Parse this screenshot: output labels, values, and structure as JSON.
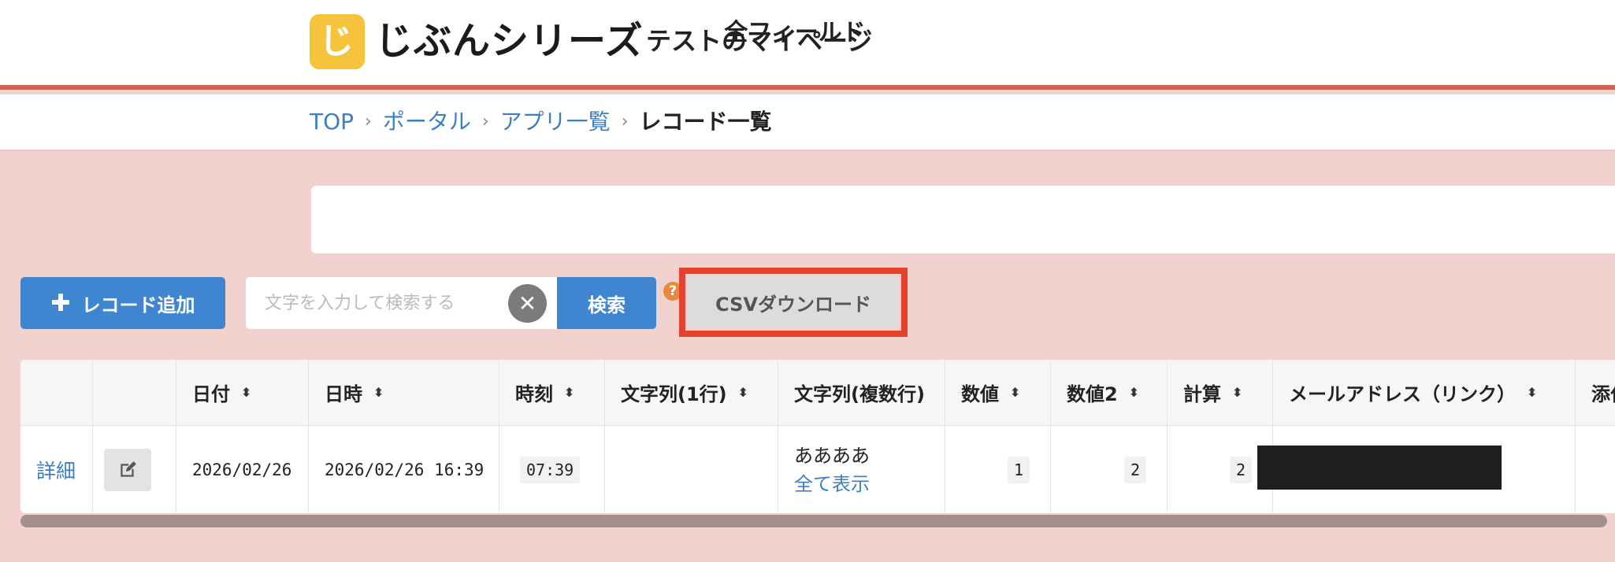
{
  "header": {
    "logo_mark": "じ",
    "brand": "じぶんシリーズ",
    "page_owner": "テストのマイページ"
  },
  "breadcrumb": {
    "items": [
      "TOP",
      "ポータル",
      "アプリ一覧"
    ],
    "current": "レコード一覧",
    "separator": "›"
  },
  "panel": {
    "title": "全フィールド"
  },
  "toolbar": {
    "add_record": "レコード追加",
    "search_placeholder": "文字を入力して検索する",
    "search_button": "検索",
    "help": "?",
    "csv_download": "CSVダウンロード"
  },
  "table": {
    "columns": [
      "日付",
      "日時",
      "時刻",
      "文字列(1行)",
      "文字列(複数行)",
      "数値",
      "数値2",
      "計算",
      "メールアドレス（リンク）",
      "添付"
    ],
    "sort_glyph": "⬍",
    "rows": [
      {
        "detail": "詳細",
        "date": "2026/02/26",
        "datetime": "2026/02/26 16:39",
        "time": "07:39",
        "text_single": "",
        "text_multi": "ああああ",
        "show_all": "全て表示",
        "number": "1",
        "number2": "2",
        "calc": "2"
      }
    ]
  },
  "colors": {
    "accent": "#3f85cf",
    "header_border": "#d9604f",
    "background": "#f2d2cf",
    "highlight": "#e5412d"
  }
}
